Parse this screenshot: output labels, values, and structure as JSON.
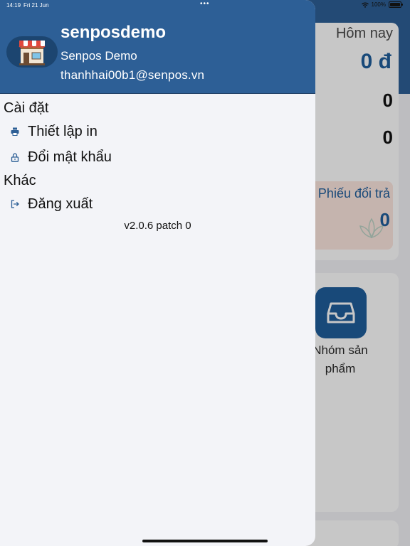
{
  "status_bar": {
    "time": "14:19",
    "date": "Fri 21 Jun",
    "dots": "•••",
    "battery": "100%",
    "wifi_icon": "wifi-icon",
    "battery_icon": "battery-icon"
  },
  "drawer": {
    "header": {
      "store_name": "senposdemo",
      "store_display_name": "Senpos Demo",
      "email": "thanhhai00b1@senpos.vn",
      "avatar_icon": "storefront-icon"
    },
    "sections": [
      {
        "title": "Cài đặt",
        "items": [
          {
            "label": "Thiết lập in",
            "icon": "printer-icon"
          },
          {
            "label": "Đổi mật khẩu",
            "icon": "lock-icon"
          }
        ]
      },
      {
        "title": "Khác",
        "items": [
          {
            "label": "Đăng xuất",
            "icon": "logout-icon"
          }
        ]
      }
    ],
    "version": "v2.0.6 patch 0"
  },
  "background": {
    "today_label": "Hôm nay",
    "revenue": "0 đ",
    "count_1": "0",
    "count_2": "0",
    "return_label": "Phiếu đổi trả",
    "return_count": "0",
    "group_tile_label": "Nhóm sản phẩm"
  },
  "colors": {
    "header_blue": "#2d5f96",
    "accent_blue": "#1f5e9c",
    "drawer_bg": "#f3f4f8"
  }
}
